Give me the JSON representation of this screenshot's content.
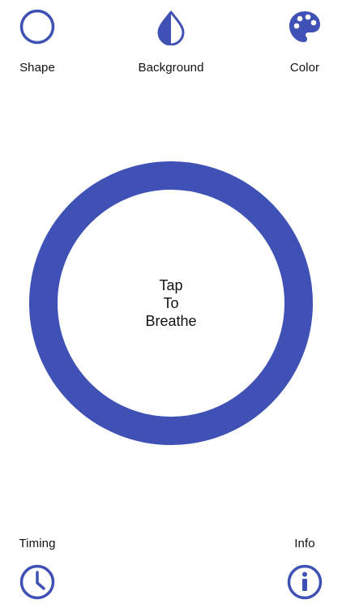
{
  "theme": {
    "accent": "#3f51b5",
    "text": "#111111",
    "background": "#ffffff"
  },
  "toolbar": {
    "shape": {
      "label": "Shape",
      "icon": "circle-outline-icon"
    },
    "background": {
      "label": "Background",
      "icon": "half-drop-icon"
    },
    "color": {
      "label": "Color",
      "icon": "palette-icon"
    }
  },
  "breath": {
    "lines": [
      "Tap",
      "To",
      "Breathe"
    ]
  },
  "footer": {
    "timing": {
      "label": "Timing",
      "icon": "clock-icon"
    },
    "info": {
      "label": "Info",
      "icon": "info-icon"
    }
  }
}
